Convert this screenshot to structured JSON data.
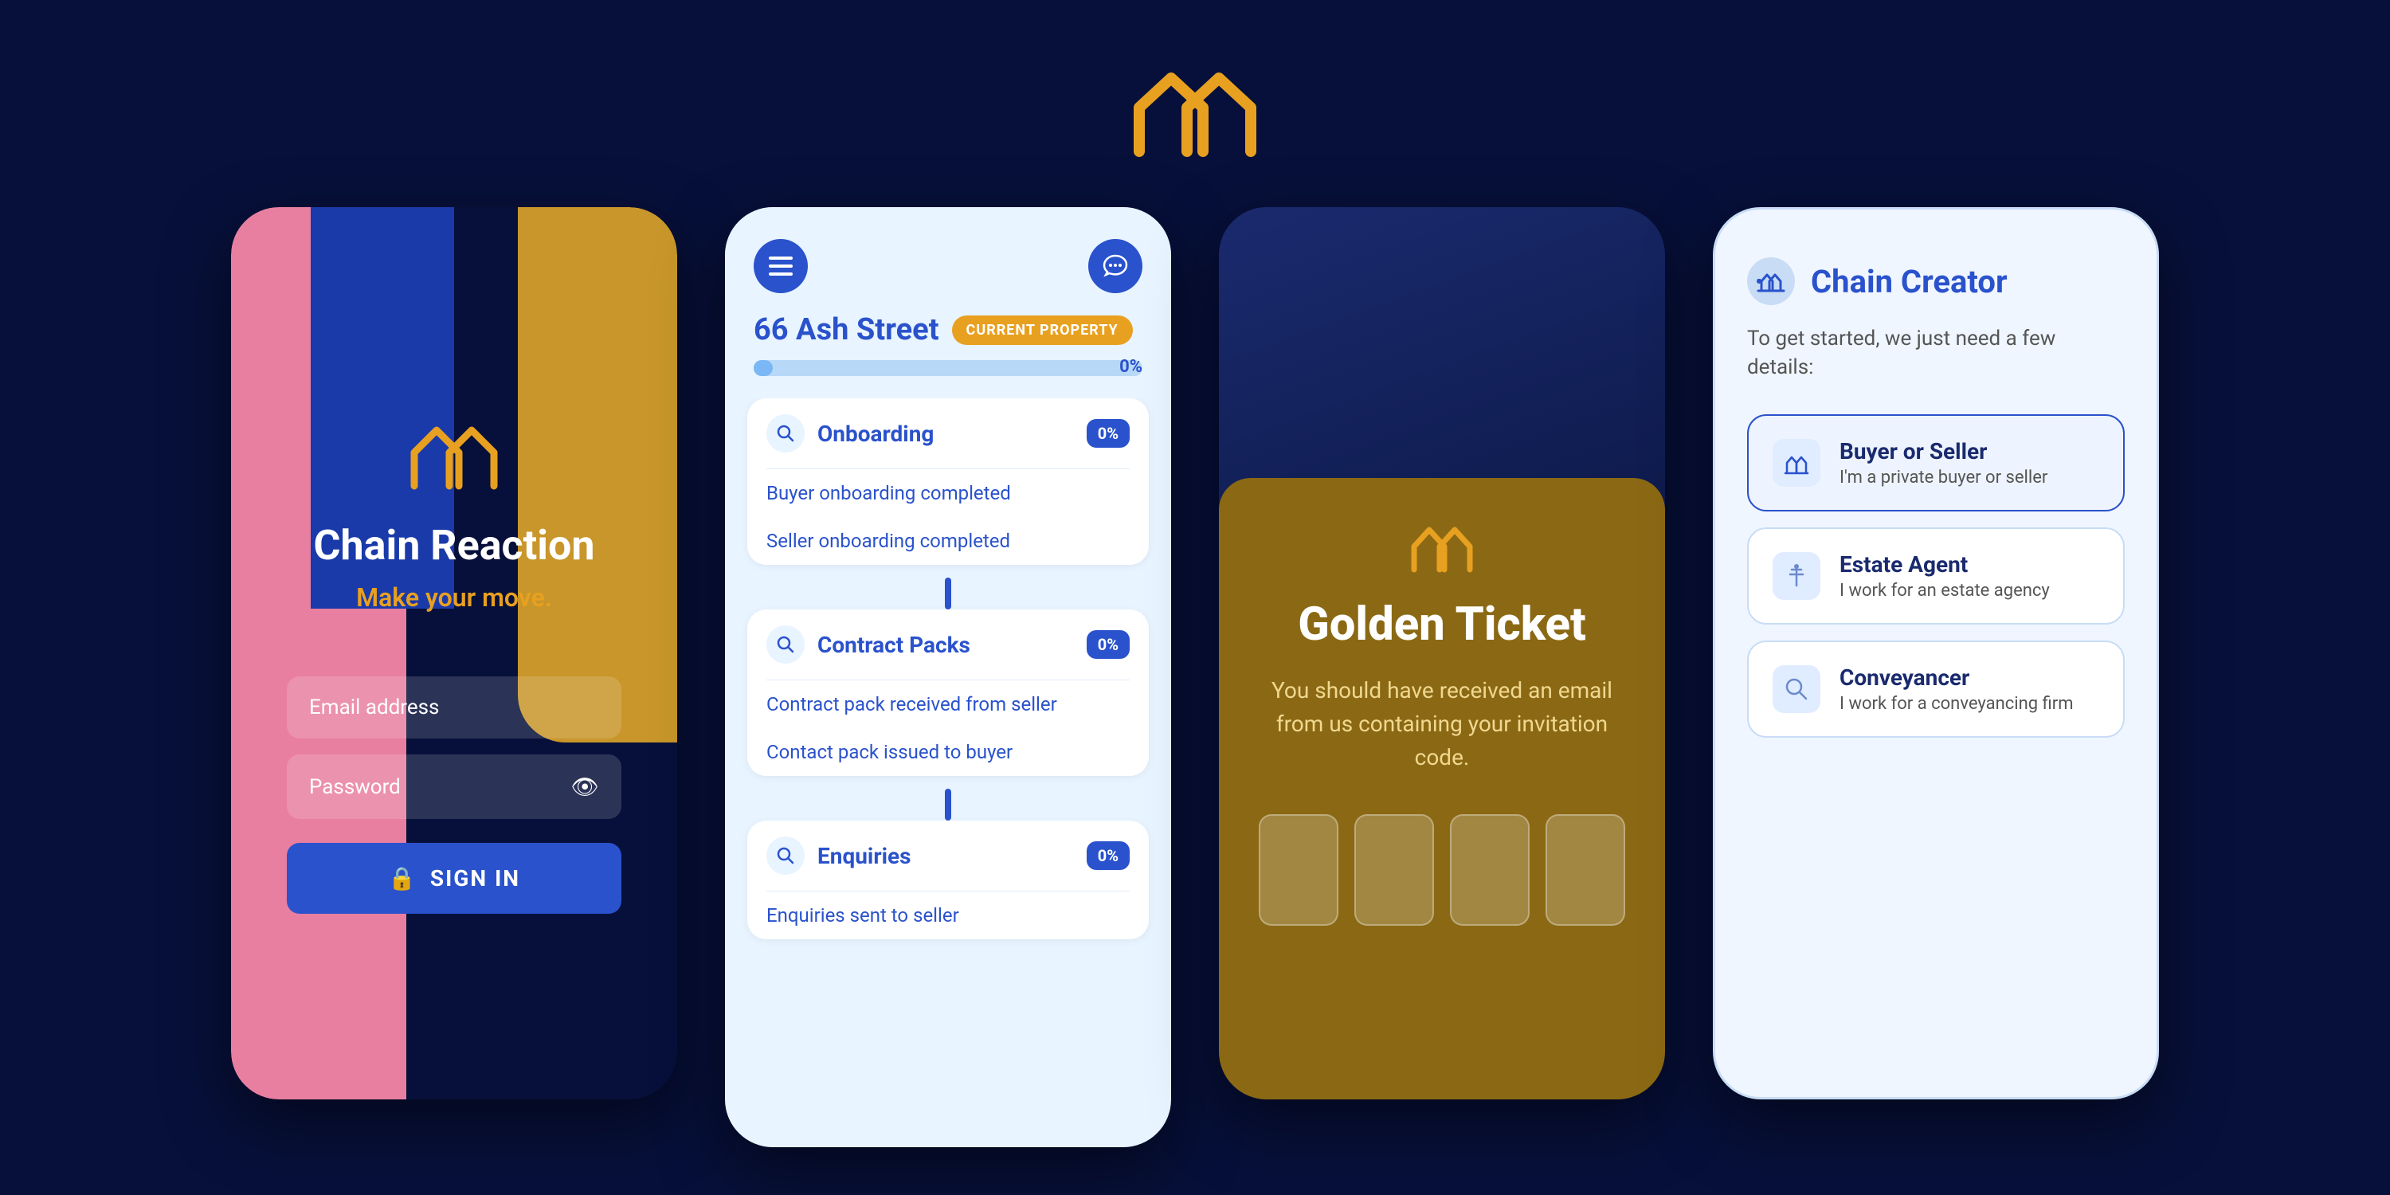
{
  "app": {
    "background": "#07103a",
    "logo_color": "#e8a020"
  },
  "header": {
    "logo_alt": "Chain Reaction Logo"
  },
  "phone1": {
    "app_name": "Chain Reaction",
    "tagline": "Make your move.",
    "email_label": "Email address",
    "password_label": "Password",
    "sign_in_label": "SIGN IN"
  },
  "phone2": {
    "address": "66 Ash Street",
    "badge": "CURRENT  PROPERTY",
    "progress_pct": "0%",
    "sections": [
      {
        "title": "Onboarding",
        "pct": "0%",
        "items": [
          "Buyer onboarding completed",
          "Seller onboarding completed"
        ]
      },
      {
        "title": "Contract Packs",
        "pct": "0%",
        "items": [
          "Contract pack received from seller",
          "Contact pack issued to buyer"
        ]
      },
      {
        "title": "Enquiries",
        "pct": "0%",
        "items": [
          "Enquiries sent to seller"
        ]
      }
    ]
  },
  "phone3": {
    "title": "Golden Ticket",
    "description": "You should have received an email from us containing your invitation code."
  },
  "phone4": {
    "header_title": "Chain Creator",
    "subtitle": "To get started, we just need a few details:",
    "roles": [
      {
        "name": "Buyer or Seller",
        "desc": "I'm a private buyer or seller",
        "icon": "🏠"
      },
      {
        "name": "Estate Agent",
        "desc": "I work for an estate agency",
        "icon": "📍"
      },
      {
        "name": "Conveyancer",
        "desc": "I work for a conveyancing firm",
        "icon": "🔍"
      }
    ]
  }
}
